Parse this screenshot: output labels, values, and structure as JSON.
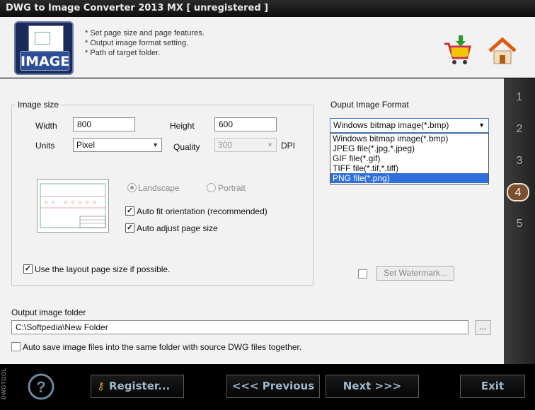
{
  "window": {
    "title": "DWG to Image Converter 2013 MX [ unregistered ]"
  },
  "header": {
    "logo_label": "IMAGE",
    "tips": [
      "* Set page size and page features.",
      "* Output image format setting.",
      "* Path of target folder."
    ],
    "icons": [
      "shopping-cart-icon",
      "home-icon"
    ]
  },
  "steps": [
    "1",
    "2",
    "3",
    "4",
    "5"
  ],
  "active_step": "4",
  "image_size": {
    "group_label": "Image size",
    "width_label": "Width",
    "width_value": "800",
    "height_label": "Height",
    "height_value": "600",
    "units_label": "Units",
    "units_value": "Pixel",
    "quality_label": "Quality",
    "quality_value": "300",
    "dpi_label": "DPI",
    "landscape_label": "Landscape",
    "portrait_label": "Portrait",
    "auto_fit_label": "Auto fit orientation (recommended)",
    "auto_fit_checked": true,
    "auto_adjust_label": "Auto adjust page size",
    "auto_adjust_checked": true,
    "layout_size_label": "Use the layout page size if possible.",
    "layout_size_checked": true
  },
  "output_format": {
    "label": "Ouput Image Format",
    "selected": "Windows bitmap image(*.bmp)",
    "options": [
      "Windows bitmap image(*.bmp)",
      "JPEG file(*.jpg,*.jpeg)",
      "GIF file(*.gif)",
      "TIFF file(*.tif,*.tiff)",
      "PNG file(*.png)"
    ],
    "highlighted_option": "PNG file(*.png)",
    "watermark_label": "Set Watermark..."
  },
  "output_folder": {
    "label": "Output image folder",
    "path": "C:\\Softpedia\\New Folder",
    "browse_label": "...",
    "auto_save_label": "Auto save image files into the same folder with source DWG files together."
  },
  "footer": {
    "side_label": "DWGTOOL",
    "register_label": "Register...",
    "previous_label": "<<< Previous",
    "next_label": "Next >>>",
    "exit_label": "Exit"
  }
}
